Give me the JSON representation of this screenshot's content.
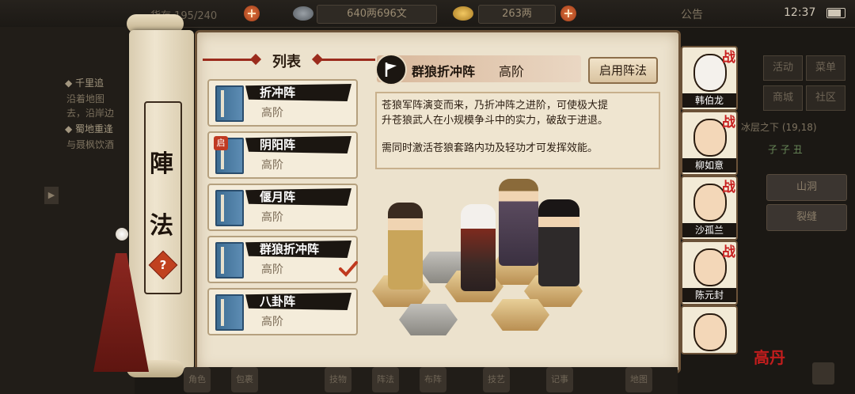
{
  "topbar": {
    "storage": "货存 195/240",
    "silver": "640两696文",
    "gold": "263两",
    "announcement": "公告",
    "time": "12:37"
  },
  "background": {
    "quest1_title": "◆ 千里追",
    "quest1_line1": "沿着地图",
    "quest1_line2": "去，沿岸边",
    "quest2_title": "◆ 蜀地重逢",
    "quest2_line1": "与聂枫饮酒",
    "menu": [
      "活动",
      "菜单",
      "商城",
      "社区"
    ],
    "location": "冰层之下 (19,18)",
    "coords": "子 子 丑",
    "buttons": [
      "山洞",
      "裂缝"
    ],
    "bottom_tabs": [
      "角色",
      "包裹",
      "技物",
      "阵法",
      "布阵",
      "技艺",
      "记事",
      "地图"
    ]
  },
  "scroll": {
    "char1": "陣",
    "char2": "法",
    "help": "?"
  },
  "list": {
    "title": "列表",
    "items": [
      {
        "name": "折冲阵",
        "tier": "高阶",
        "badge": ""
      },
      {
        "name": "阴阳阵",
        "tier": "高阶",
        "badge": "启"
      },
      {
        "name": "偃月阵",
        "tier": "高阶",
        "badge": ""
      },
      {
        "name": "群狼折冲阵",
        "tier": "高阶",
        "badge": ""
      },
      {
        "name": "八卦阵",
        "tier": "高阶",
        "badge": ""
      }
    ]
  },
  "detail": {
    "name": "群狼折冲阵",
    "tier": "高阶",
    "activate": "启用阵法",
    "desc_line1": "苍狼军阵演变而来，乃折冲阵之进阶，可使极大提",
    "desc_line2": "升苍狼武人在小规模争斗中的实力，破敌于进退。",
    "desc_line3": "需同时激活苍狼套路内功及轻功才可发挥效能。"
  },
  "roster": [
    {
      "name": "韩伯龙",
      "mark": "战"
    },
    {
      "name": "柳如意",
      "mark": "战"
    },
    {
      "name": "沙孤兰",
      "mark": "战"
    },
    {
      "name": "陈元封",
      "mark": "战"
    },
    {
      "name": "",
      "mark": ""
    }
  ],
  "corner_stamp": "高丹",
  "colors": {
    "accent_red": "#c03a22",
    "panel_bg": "#ece2cd",
    "dark_bar": "#1b1611"
  }
}
